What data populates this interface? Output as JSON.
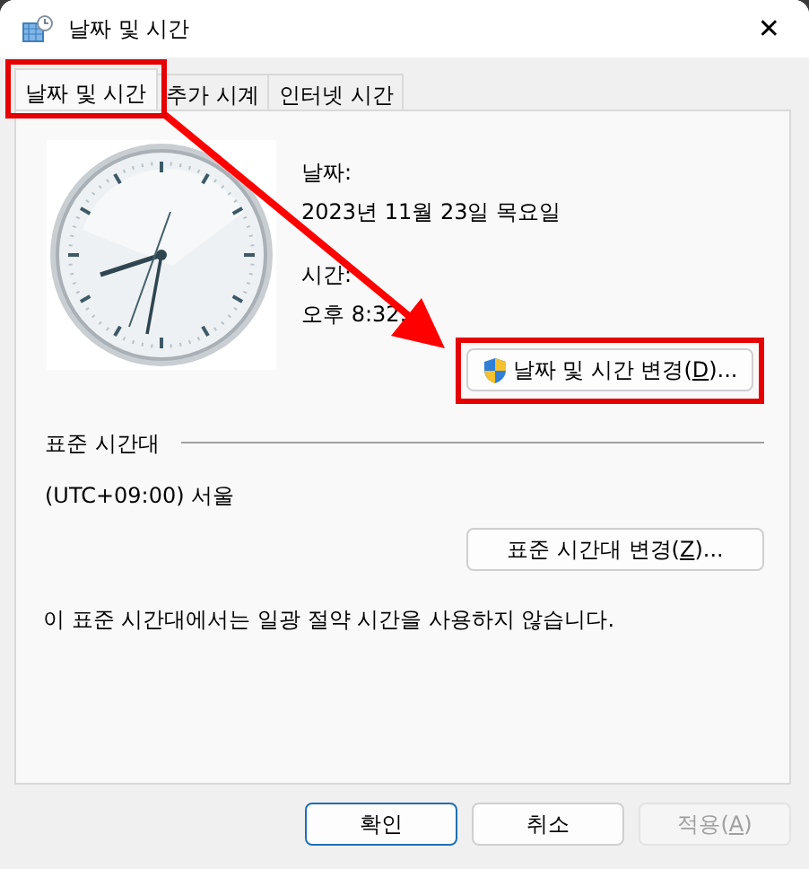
{
  "window": {
    "title": "날짜 및 시간",
    "close": "✕"
  },
  "tabs": [
    {
      "label": "날짜 및 시간",
      "selected": true,
      "highlighted": true
    },
    {
      "label": "추가 시계",
      "selected": false,
      "highlighted": false
    },
    {
      "label": "인터넷 시간",
      "selected": false,
      "highlighted": false
    }
  ],
  "date": {
    "label": "날짜:",
    "value": "2023년 11월 23일 목요일"
  },
  "time": {
    "label": "시간:",
    "value": "오후 8:32:"
  },
  "change_datetime_button": {
    "before": "날짜 및 시간 변경(",
    "key": "D",
    "after": ")...",
    "shield": true,
    "highlighted": true
  },
  "timezone": {
    "heading": "표준 시간대",
    "value": "(UTC+09:00) 서울"
  },
  "change_timezone_button": {
    "before": "표준 시간대 변경(",
    "key": "Z",
    "after": ")..."
  },
  "dst_note": "이 표준 시간대에서는 일광 절약 시간을 사용하지 않습니다.",
  "annotation_arrow": true,
  "buttons": [
    {
      "label": "확인",
      "kind": "default",
      "disabled": false
    },
    {
      "label": "취소",
      "kind": "normal",
      "disabled": false
    },
    {
      "before": "적용(",
      "key": "A",
      "after": ")",
      "kind": "normal",
      "disabled": true
    }
  ]
}
